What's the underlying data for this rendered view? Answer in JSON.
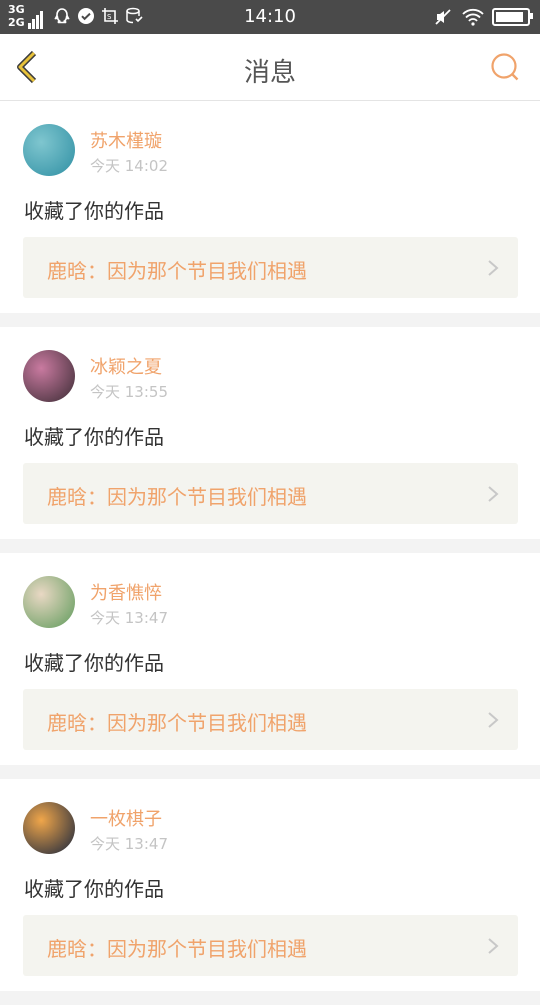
{
  "status_bar": {
    "network_top": "3G",
    "network_bottom": "2G",
    "time": "14:10",
    "battery_level": 0.9
  },
  "header": {
    "title": "消息"
  },
  "messages": [
    {
      "name": "苏木槿璇",
      "time": "今天 14:02",
      "action": "收藏了你的作品",
      "work": "鹿晗：因为那个节目我们相遇",
      "avatar_colors": [
        "#7fc6cf",
        "#2f8fa3"
      ]
    },
    {
      "name": "冰颖之夏",
      "time": "今天 13:55",
      "action": "收藏了你的作品",
      "work": "鹿晗：因为那个节目我们相遇",
      "avatar_colors": [
        "#c97aa0",
        "#3a2b33"
      ]
    },
    {
      "name": "为香憔悴",
      "time": "今天 13:47",
      "action": "收藏了你的作品",
      "work": "鹿晗：因为那个节目我们相遇",
      "avatar_colors": [
        "#e9d8c4",
        "#5e9a5a"
      ]
    },
    {
      "name": "一枚棋子",
      "time": "今天 13:47",
      "action": "收藏了你的作品",
      "work": "鹿晗：因为那个节目我们相遇",
      "avatar_colors": [
        "#f0a64a",
        "#15233d"
      ]
    }
  ],
  "colors": {
    "accent": "#f0a36b",
    "back_arrow": "#e8c23a",
    "status_bar_bg": "#4a4a4a"
  }
}
